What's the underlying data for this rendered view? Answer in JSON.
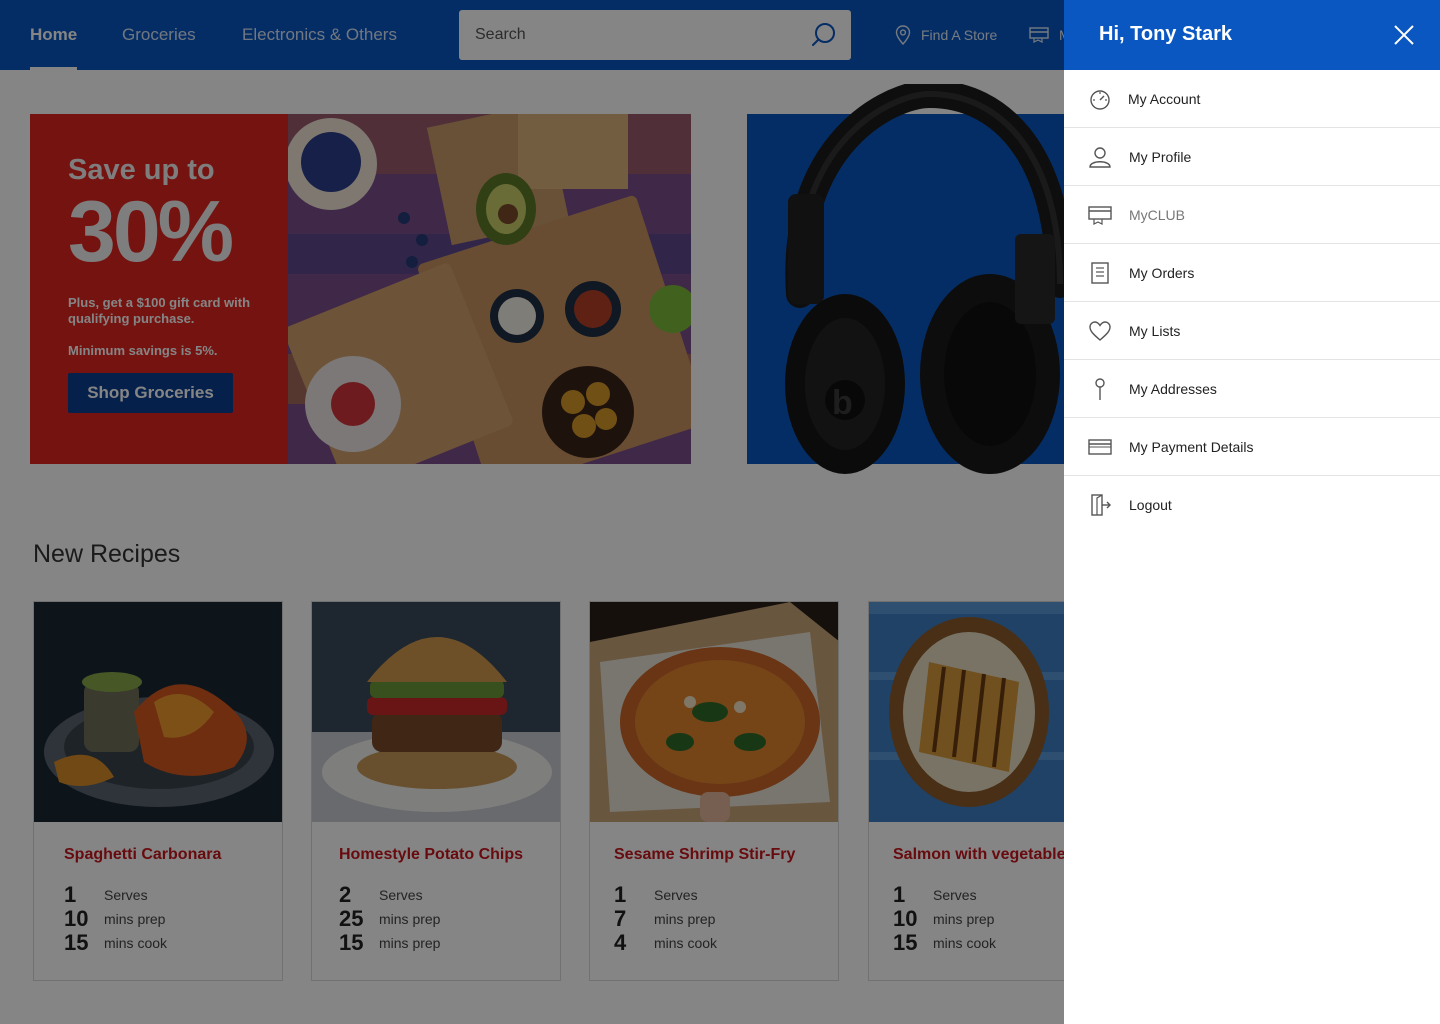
{
  "header": {
    "tabs": [
      {
        "label": "Home",
        "active": true
      },
      {
        "label": "Groceries",
        "active": false
      },
      {
        "label": "Electronics & Others",
        "active": false
      }
    ],
    "search": {
      "placeholder": "Search",
      "icon": "search-icon"
    },
    "links": [
      {
        "label": "Find A Store",
        "icon": "location-pin-icon"
      },
      {
        "label": "M",
        "icon": "card-icon"
      }
    ],
    "bg_color": "#0a57c2"
  },
  "promo": {
    "headline": "Save up to",
    "percent": "30%",
    "subtext": "Plus, get a $100 gift card with qualifying purchase.",
    "minimum": "Minimum savings is 5%.",
    "button_label": "Shop Groceries",
    "bg_color": "#e0261f"
  },
  "electronics_banner": {
    "bg_color": "#0a57c2",
    "product": "headphones"
  },
  "recipes": {
    "title": "New Recipes",
    "cards": [
      {
        "title": "Spaghetti Carbonara",
        "stats": [
          {
            "num": "1",
            "label": "Serves"
          },
          {
            "num": "10",
            "label": "mins prep"
          },
          {
            "num": "15",
            "label": "mins cook"
          }
        ]
      },
      {
        "title": "Homestyle Potato Chips",
        "stats": [
          {
            "num": "2",
            "label": "Serves"
          },
          {
            "num": "25",
            "label": "mins prep"
          },
          {
            "num": "15",
            "label": "mins prep"
          }
        ]
      },
      {
        "title": "Sesame Shrimp Stir-Fry",
        "stats": [
          {
            "num": "1",
            "label": "Serves"
          },
          {
            "num": "7",
            "label": "mins prep"
          },
          {
            "num": "4",
            "label": "mins cook"
          }
        ]
      },
      {
        "title": "Salmon with vegetables",
        "stats": [
          {
            "num": "1",
            "label": "Serves"
          },
          {
            "num": "10",
            "label": "mins prep"
          },
          {
            "num": "15",
            "label": "mins cook"
          }
        ]
      }
    ]
  },
  "panel": {
    "greeting": "Hi, Tony Stark",
    "close_icon": "close-icon",
    "items": [
      {
        "label": "My Account",
        "icon": "dashboard-icon"
      },
      {
        "label": "My Profile",
        "icon": "user-icon"
      },
      {
        "label": "MyCLUB",
        "icon": "club-card-icon"
      },
      {
        "label": "My Orders",
        "icon": "receipt-icon"
      },
      {
        "label": "My Lists",
        "icon": "heart-icon"
      },
      {
        "label": "My Addresses",
        "icon": "pin-icon"
      },
      {
        "label": "My Payment Details",
        "icon": "credit-card-icon"
      },
      {
        "label": "Logout",
        "icon": "logout-icon"
      }
    ]
  }
}
